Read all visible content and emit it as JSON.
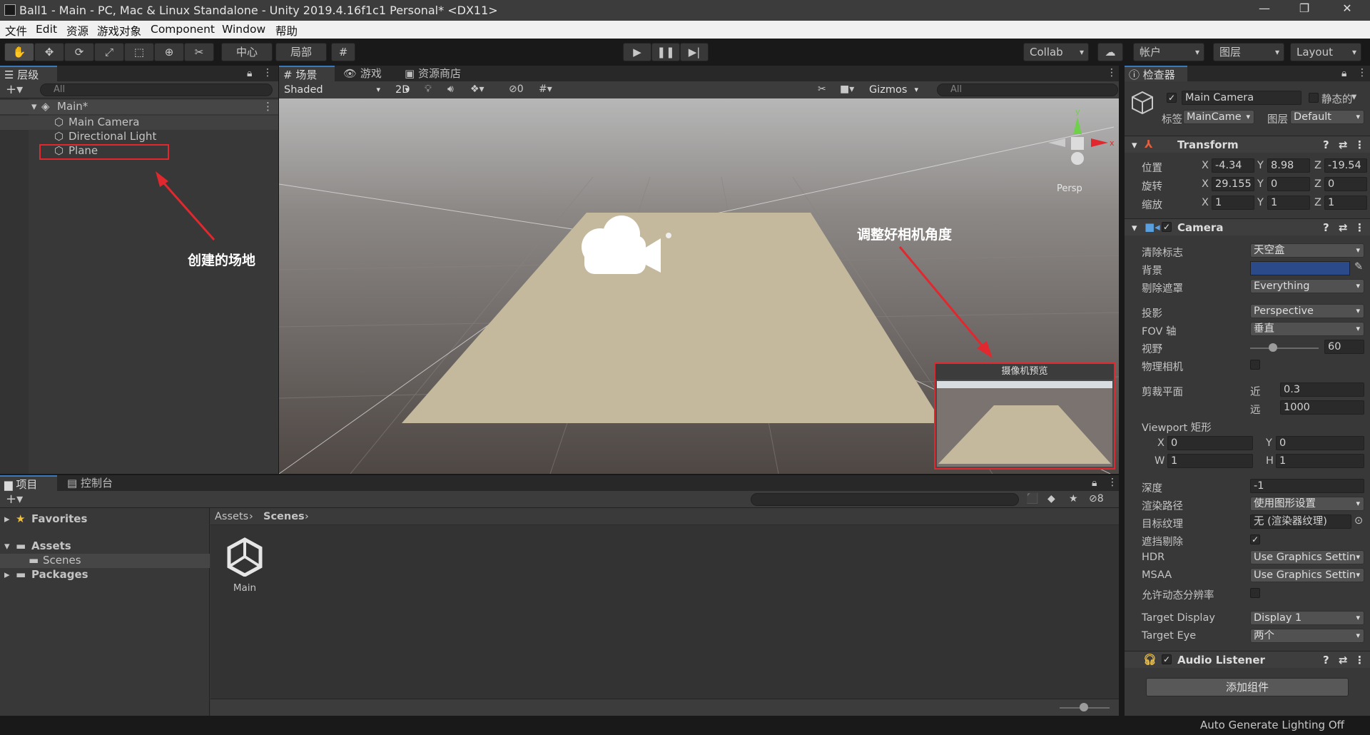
{
  "window": {
    "title": "Ball1 - Main - PC, Mac & Linux Standalone - Unity 2019.4.16f1c1 Personal* <DX11>"
  },
  "menu": [
    "文件",
    "Edit",
    "资源",
    "游戏对象",
    "Component",
    "Window",
    "帮助"
  ],
  "toolbar": {
    "pivot": "中心",
    "local": "局部",
    "collab": "Collab",
    "account": "帐户",
    "layers": "图层",
    "layout": "Layout"
  },
  "hierarchy": {
    "tab": "层级",
    "search_placeholder": "All",
    "scene": "Main*",
    "items": [
      "Main Camera",
      "Directional Light",
      "Plane"
    ]
  },
  "scene_view": {
    "tabs": [
      "场景",
      "游戏",
      "资源商店"
    ],
    "shading": "Shaded",
    "mode_2d": "2D",
    "hidden_count": "0",
    "gizmos": "Gizmos",
    "search_placeholder": "All",
    "persp": "Persp",
    "camera_preview_title": "摄像机预览"
  },
  "annotations": {
    "plane_note": "创建的场地",
    "camera_note": "调整好相机角度"
  },
  "project": {
    "tabs": [
      "项目",
      "控制台"
    ],
    "tree": [
      "Favorites",
      "Assets",
      "Scenes",
      "Packages"
    ],
    "breadcrumb": [
      "Assets",
      "Scenes"
    ],
    "asset_name": "Main",
    "hidden_count": "8"
  },
  "inspector": {
    "tab": "检查器",
    "object_name": "Main Camera",
    "static_label": "静态的",
    "tag_label": "标签",
    "tag_value": "MainCame",
    "layer_label": "图层",
    "layer_value": "Default",
    "transform": {
      "title": "Transform",
      "position_label": "位置",
      "px": "-4.34",
      "py": "8.98",
      "pz": "-19.54",
      "rotation_label": "旋转",
      "rx": "29.155",
      "ry": "0",
      "rz": "0",
      "scale_label": "缩放",
      "sx": "1",
      "sy": "1",
      "sz": "1"
    },
    "camera": {
      "title": "Camera",
      "clear_flags_label": "清除标志",
      "clear_flags": "天空盒",
      "background_label": "背景",
      "background_color": "#2a4a8a",
      "culling_label": "剔除遮罩",
      "culling": "Everything",
      "projection_label": "投影",
      "projection": "Perspective",
      "fov_axis_label": "FOV 轴",
      "fov_axis": "垂直",
      "fov_label": "视野",
      "fov": "60",
      "fov_fraction": 0.33,
      "physical_label": "物理相机",
      "clip_label": "剪裁平面",
      "near_label": "近",
      "near": "0.3",
      "far_label": "远",
      "far": "1000",
      "viewport_label": "Viewport 矩形",
      "vx": "0",
      "vy": "0",
      "vw": "1",
      "vh": "1",
      "depth_label": "深度",
      "depth": "-1",
      "render_path_label": "渲染路径",
      "render_path": "使用图形设置",
      "target_tex_label": "目标纹理",
      "target_tex": "无 (渲染器纹理)",
      "occlusion_label": "遮挡剔除",
      "hdr_label": "HDR",
      "hdr": "Use Graphics Settin",
      "msaa_label": "MSAA",
      "msaa": "Use Graphics Settin",
      "dyn_res_label": "允许动态分辨率",
      "target_display_label": "Target Display",
      "target_display": "Display 1",
      "target_eye_label": "Target Eye",
      "target_eye": "两个"
    },
    "audio_listener": "Audio Listener",
    "add_component": "添加组件"
  },
  "status": {
    "lighting": "Auto Generate Lighting Off"
  },
  "icons": [
    "hand-icon",
    "move-icon",
    "rotate-icon",
    "scale-icon",
    "rect-icon",
    "transform-icon",
    "custom-tool-icon",
    "play-icon",
    "pause-icon",
    "step-icon",
    "cloud-icon",
    "lock-icon",
    "menu-icon",
    "gear-icon",
    "help-icon",
    "camera-gizmo-icon",
    "headphone-icon"
  ]
}
